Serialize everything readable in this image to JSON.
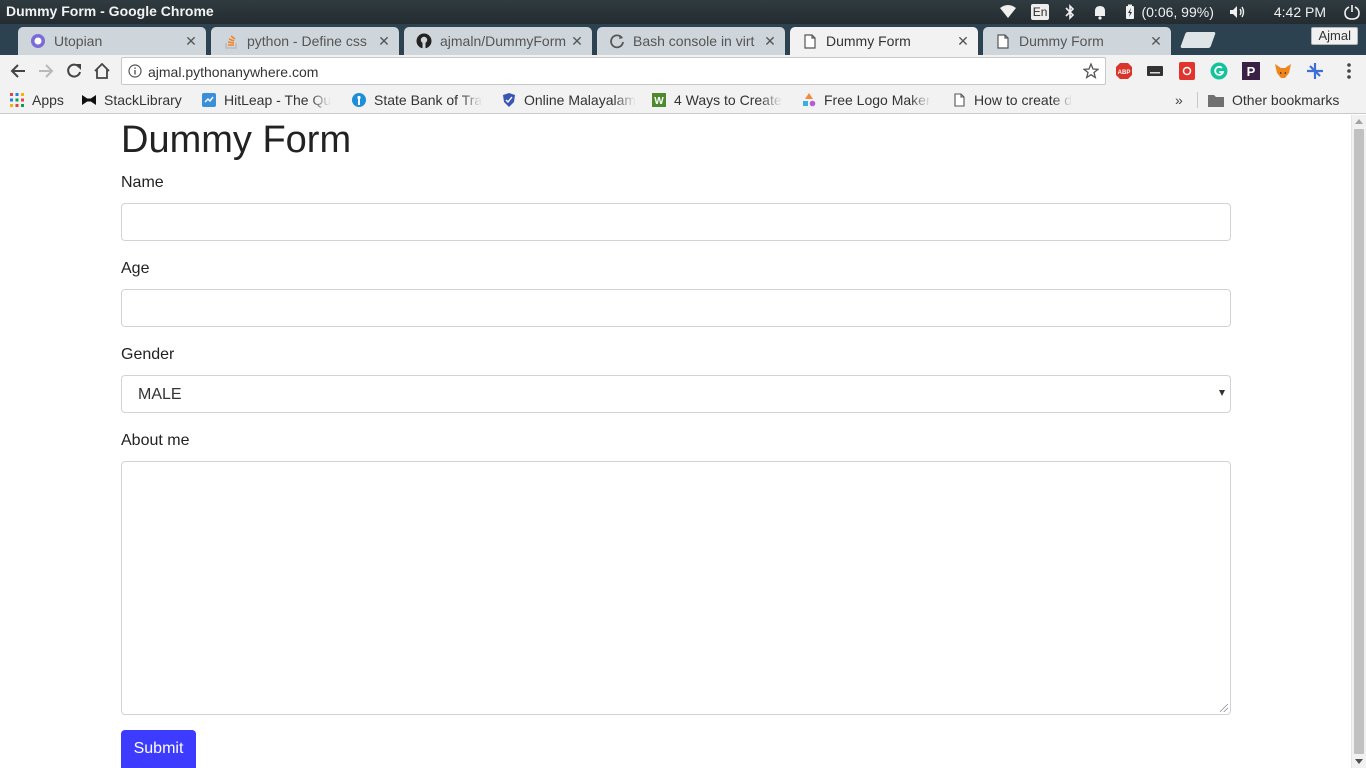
{
  "desktop": {
    "window_title": "Dummy Form - Google Chrome",
    "input_method": "En",
    "battery_text": "(0:06, 99%)",
    "clock": "4:42 PM"
  },
  "browser": {
    "profile_name": "Ajmal",
    "tabs": [
      {
        "title": "Utopian",
        "icon": "utopian-icon",
        "active": false
      },
      {
        "title": "python - Define css",
        "icon": "stackoverflow-icon",
        "active": false
      },
      {
        "title": "ajmaln/DummyForm",
        "icon": "github-icon",
        "active": false
      },
      {
        "title": "Bash console in virt",
        "icon": "loading-icon",
        "active": false
      },
      {
        "title": "Dummy Form",
        "icon": "page-icon",
        "active": true
      },
      {
        "title": "Dummy Form",
        "icon": "page-icon",
        "active": false
      }
    ],
    "address": "ajmal.pythonanywhere.com",
    "bookmarks": [
      {
        "label": "Apps",
        "icon": "apps-grid-icon"
      },
      {
        "label": "StackLibrary",
        "icon": "bow-icon"
      },
      {
        "label": "HitLeap - The Qu",
        "icon": "hitleap-icon"
      },
      {
        "label": "State Bank of Tra",
        "icon": "sbt-icon"
      },
      {
        "label": "Online Malayalam",
        "icon": "shield-icon"
      },
      {
        "label": "4 Ways to Create",
        "icon": "wikihow-icon"
      },
      {
        "label": "Free Logo Maker",
        "icon": "logo-maker-icon"
      },
      {
        "label": "How to create d",
        "icon": "page-icon"
      }
    ],
    "other_bookmarks": "Other bookmarks",
    "overflow": "»"
  },
  "form": {
    "title": "Dummy Form",
    "name_label": "Name",
    "name_value": "",
    "age_label": "Age",
    "age_value": "",
    "gender_label": "Gender",
    "gender_value": "MALE",
    "about_label": "About me",
    "about_value": "",
    "submit_label": "Submit"
  },
  "colors": {
    "submit_bg": "#3d3bff",
    "tabstrip_bg": "#2d4250"
  }
}
